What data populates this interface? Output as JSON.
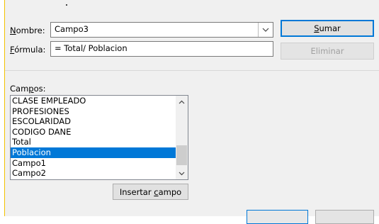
{
  "nombre": {
    "label_u": "N",
    "label_rest": "ombre:",
    "value": "Campo3"
  },
  "formula": {
    "label_u": "F",
    "label_rest": "órmula:",
    "value": "= Total/ Poblacion"
  },
  "buttons": {
    "sumar_u": "S",
    "sumar_rest": "umar",
    "eliminar": "Eliminar",
    "insertar_pre": "Insertar ",
    "insertar_u": "c",
    "insertar_rest": "ampo"
  },
  "campos": {
    "label_pre": "Cam",
    "label_u": "p",
    "label_rest": "os:",
    "items": [
      "CLASE EMPLEADO",
      "PROFESIONES",
      "ESCOLARIDAD",
      "CODIGO DANE",
      "Total",
      "Poblacion",
      "Campo1",
      "Campo2"
    ],
    "selected_index": 5
  },
  "icons": {
    "combo_arrow": "chevron-down-icon",
    "scroll_up": "chevron-up-icon",
    "scroll_down": "chevron-down-icon"
  },
  "colors": {
    "selection": "#0078d7",
    "default_button_border": "#0078d7"
  }
}
